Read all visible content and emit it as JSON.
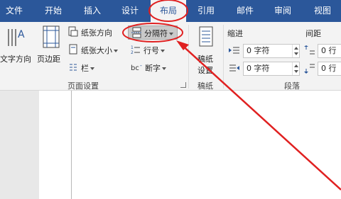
{
  "tabs": [
    {
      "label": "文件"
    },
    {
      "label": "开始"
    },
    {
      "label": "插入"
    },
    {
      "label": "设计"
    },
    {
      "label": "布局"
    },
    {
      "label": "引用"
    },
    {
      "label": "邮件"
    },
    {
      "label": "审阅"
    },
    {
      "label": "视图"
    }
  ],
  "page_setup": {
    "text_direction": "文字方向",
    "margins": "页边距",
    "orientation": "纸张方向",
    "size": "纸张大小",
    "columns": "栏",
    "breaks": "分隔符",
    "line_numbers": "行号",
    "hyphenation": "断字",
    "group_label": "页面设置"
  },
  "draft": {
    "label_line1": "稿纸",
    "label_line2": "设置",
    "group_label": "稿纸"
  },
  "paragraph": {
    "indent_label": "缩进",
    "spacing_label": "间距",
    "indent_left": "0 字符",
    "indent_right": "0 字符",
    "spacing_before": "0 行",
    "spacing_after": "0 行",
    "group_label": "段落"
  },
  "colors": {
    "tab_bar": "#2b579a",
    "annotation": "#e02020"
  }
}
